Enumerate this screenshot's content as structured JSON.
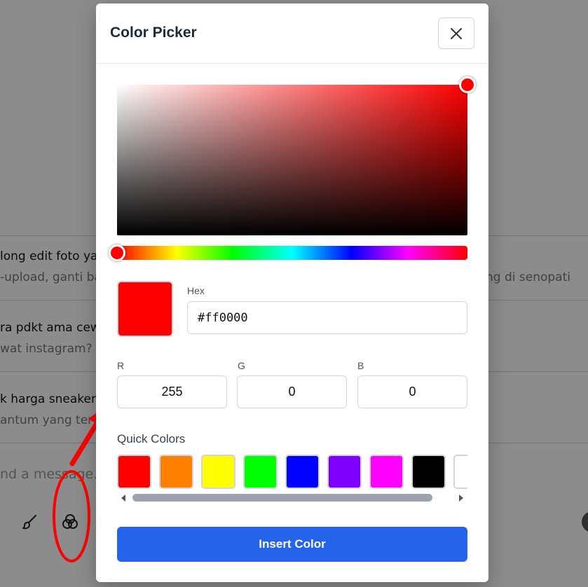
{
  "background": {
    "conversations": [
      {
        "title": "long edit foto yan",
        "subtitle": "-upload, ganti ba"
      },
      {
        "title": "ra pdkt ama cew",
        "subtitle": "wat instagram?"
      },
      {
        "title": "k harga sneaker",
        "subtitle": "antum yang ter"
      }
    ],
    "right_snippet": "ng di senopati",
    "message_placeholder": "nd a message...",
    "toolbar_icons": [
      "brush-icon",
      "color-circles-icon"
    ]
  },
  "modal": {
    "title": "Color Picker",
    "close_icon": "close-icon",
    "hex_label": "Hex",
    "hex_value": "#ff0000",
    "r_label": "R",
    "g_label": "G",
    "b_label": "B",
    "r_value": "255",
    "g_value": "0",
    "b_value": "0",
    "preview_color": "#ff0000",
    "hue_color": "#ff0000",
    "quick_colors_label": "Quick Colors",
    "quick_colors": [
      "#ff0000",
      "#ff8000",
      "#ffff00",
      "#00ff00",
      "#0000ff",
      "#8000ff",
      "#ff00ff",
      "#000000",
      "#ffffff"
    ],
    "insert_button": "Insert Color"
  },
  "colors": {
    "accent": "#2563eb",
    "annotation": "#ff0000"
  }
}
